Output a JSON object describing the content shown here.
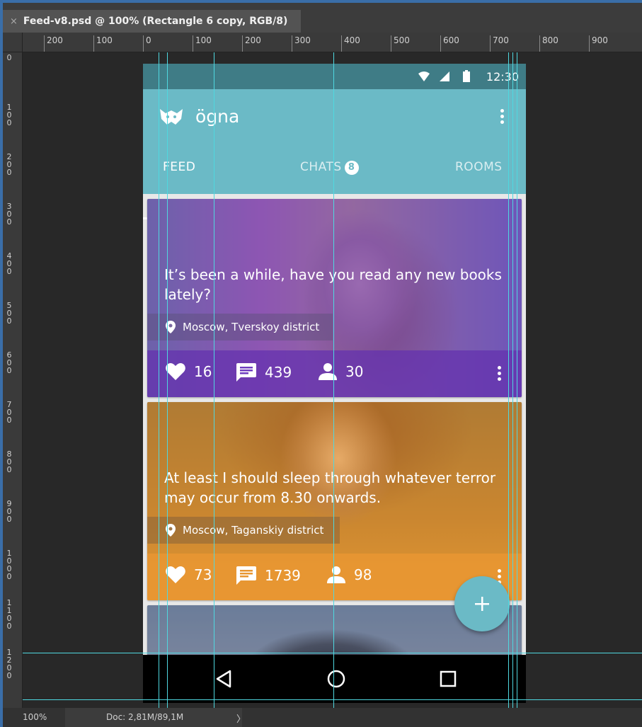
{
  "window": {
    "doc_tab_close": "×",
    "doc_tab_title": "Feed-v8.psd @ 100% (Rectangle 6 copy, RGB/8)"
  },
  "rulers": {
    "horizontal": [
      "200",
      "100",
      "0",
      "100",
      "200",
      "300",
      "400",
      "500",
      "600",
      "700",
      "800",
      "900"
    ],
    "vertical": [
      "0",
      "100",
      "200",
      "300",
      "400",
      "500",
      "600",
      "700",
      "800",
      "900",
      "1000",
      "1100",
      "1200"
    ]
  },
  "status_bar": {
    "zoom": "100%",
    "doc_info": "Doc: 2,81M/89,1M",
    "arrow": "〉"
  },
  "phone": {
    "status": {
      "time": "12:30"
    },
    "app": {
      "name": "ögna",
      "logo_icon": "fox-logo-icon",
      "tabs": [
        {
          "label": "FEED",
          "active": true
        },
        {
          "label": "CHATS",
          "badge": "8",
          "active": false
        },
        {
          "label": "ROOMS",
          "active": false
        }
      ]
    },
    "posts": [
      {
        "text": "It’s been a while, have you read any new books lately?",
        "location": "Moscow, Tverskoy district",
        "likes": "16",
        "comments": "439",
        "people": "30",
        "tint": "#6e3cbe"
      },
      {
        "text": "At least I should sleep through whatever terror may occur from 8.30 onwards.",
        "location": "Moscow, Taganskiy district",
        "likes": "73",
        "comments": "1739",
        "people": "98",
        "tint": "#e89632"
      }
    ],
    "fab_icon": "plus-icon",
    "accent": "#6bbac6"
  }
}
